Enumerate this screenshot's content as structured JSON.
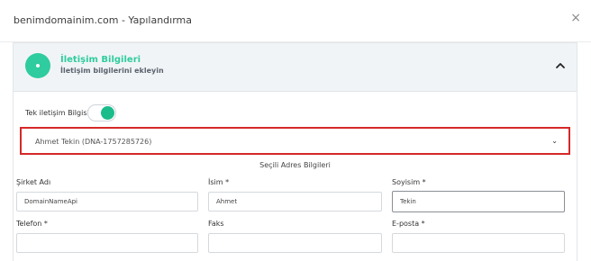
{
  "modal": {
    "title": "benimdomainim.com - Yapılandırma",
    "close_glyph": "×"
  },
  "panel": {
    "title": "İletişim Bilgileri",
    "subtitle": "İletişim bilgilerini ekleyin",
    "accent_color": "#2ecc9e"
  },
  "tek_iletisim": {
    "label": "Tek iletişim Bilgisi:",
    "enabled": true
  },
  "contact_select": {
    "value": "Ahmet Tekin (DNA-1757285726)",
    "caret": "⌄"
  },
  "section_title": "Seçili Adres Bilgileri",
  "fields": {
    "sirket": {
      "label": "Şirket Adı",
      "value": "DomainNameApi"
    },
    "isim": {
      "label": "İsim *",
      "value": "Ahmet"
    },
    "soyisim": {
      "label": "Soyisim *",
      "value": "Tekin"
    },
    "telefon": {
      "label": "Telefon *",
      "value": ""
    },
    "faks": {
      "label": "Faks",
      "value": ""
    },
    "eposta": {
      "label": "E-posta *",
      "value": ""
    }
  }
}
